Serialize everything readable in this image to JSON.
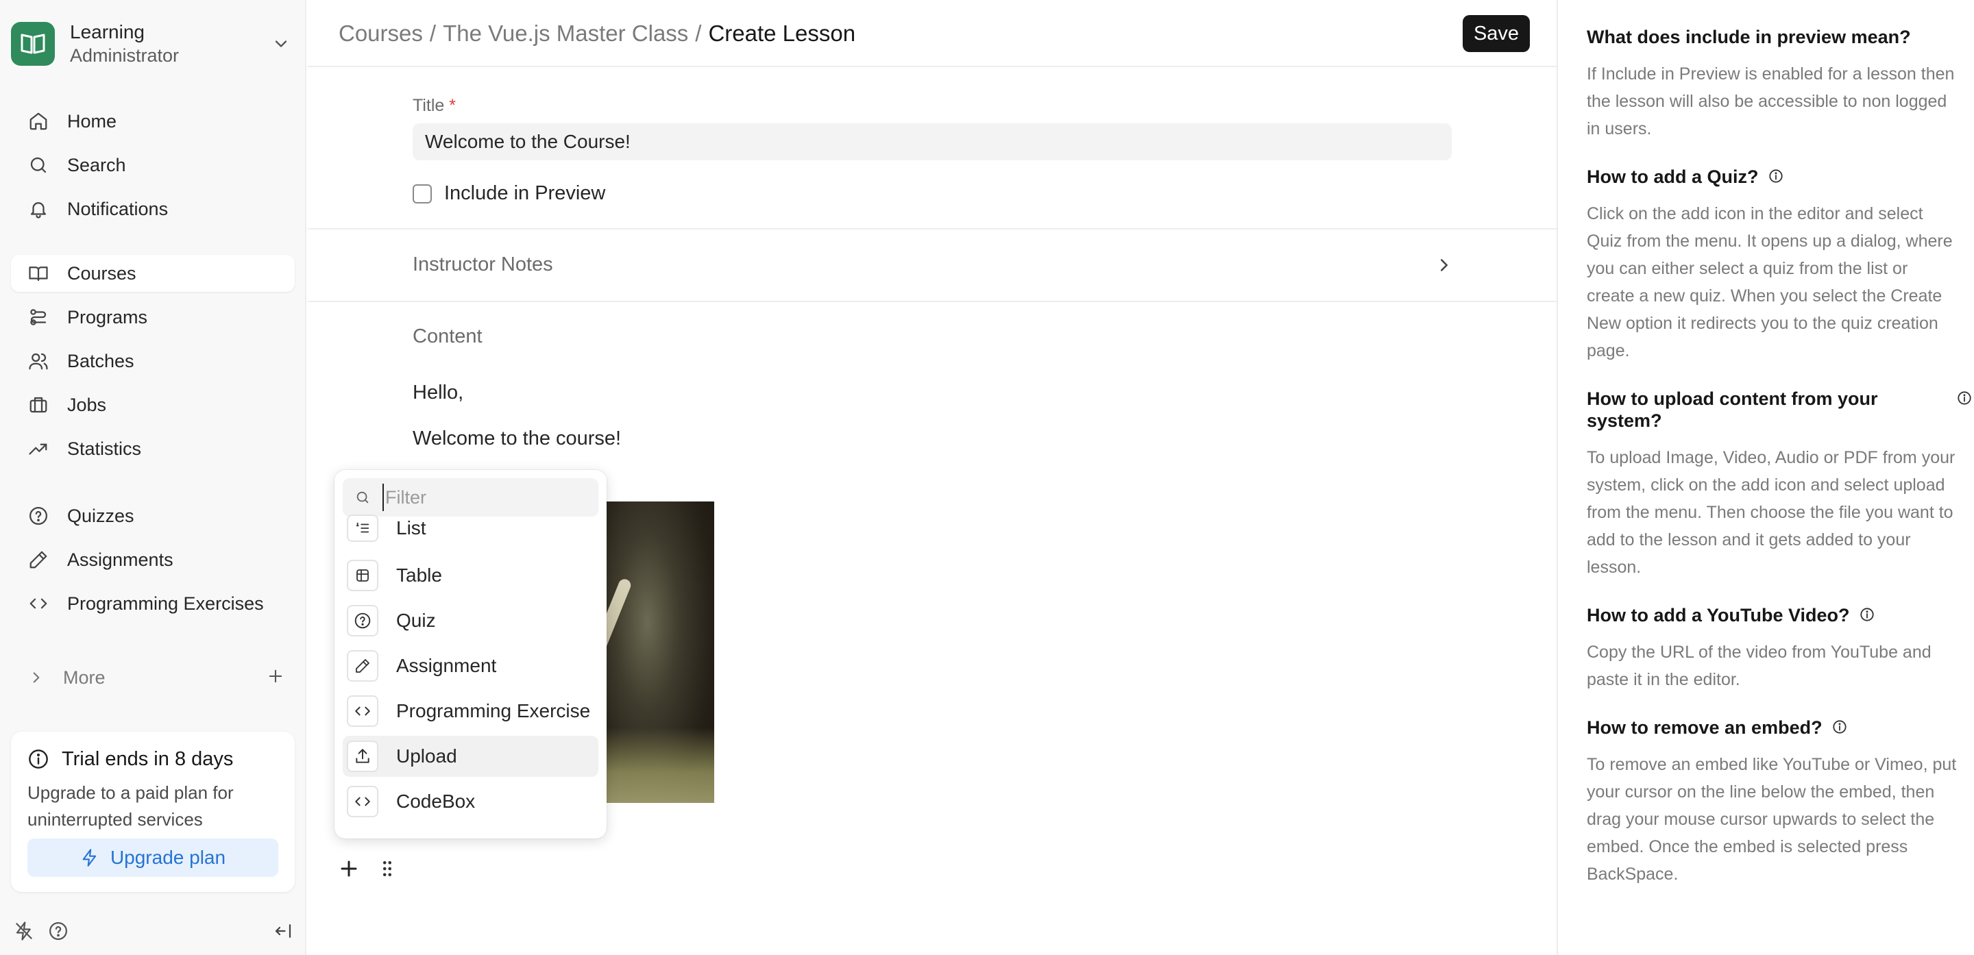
{
  "brand": {
    "title": "Learning",
    "subtitle": "Administrator",
    "color": "#2f8a5c"
  },
  "sidebar": {
    "nav_primary": [
      {
        "label": "Home",
        "icon": "home-icon"
      },
      {
        "label": "Search",
        "icon": "search-icon"
      },
      {
        "label": "Notifications",
        "icon": "bell-icon"
      }
    ],
    "nav_secondary": [
      {
        "label": "Courses",
        "icon": "book-icon",
        "active": true
      },
      {
        "label": "Programs",
        "icon": "route-icon"
      },
      {
        "label": "Batches",
        "icon": "users-icon"
      },
      {
        "label": "Jobs",
        "icon": "briefcase-icon"
      },
      {
        "label": "Statistics",
        "icon": "trending-up-icon"
      }
    ],
    "nav_tertiary": [
      {
        "label": "Quizzes",
        "icon": "help-circle-icon"
      },
      {
        "label": "Assignments",
        "icon": "pencil-icon"
      },
      {
        "label": "Programming Exercises",
        "icon": "code-icon"
      }
    ],
    "more_label": "More",
    "trial": {
      "title": "Trial ends in 8 days",
      "body": "Upgrade to a paid plan for uninterrupted services",
      "button": "Upgrade plan"
    }
  },
  "header": {
    "breadcrumb": [
      "Courses",
      "The Vue.js Master Class",
      "Create Lesson"
    ],
    "separator": "/",
    "save_label": "Save"
  },
  "form": {
    "title_label": "Title",
    "required_mark": "*",
    "title_value": "Welcome to the Course!",
    "include_preview_label": "Include in Preview",
    "include_preview_checked": false,
    "instructor_notes_label": "Instructor Notes",
    "content_label": "Content",
    "content_paragraphs": [
      "Hello,",
      "Welcome to the course!"
    ]
  },
  "insert_menu": {
    "filter_placeholder": "Filter",
    "items": [
      {
        "label": "List",
        "icon": "list-ordered-icon"
      },
      {
        "label": "Table",
        "icon": "table-icon"
      },
      {
        "label": "Quiz",
        "icon": "help-circle-icon"
      },
      {
        "label": "Assignment",
        "icon": "pencil-icon"
      },
      {
        "label": "Programming Exercise",
        "icon": "code-icon"
      },
      {
        "label": "Upload",
        "icon": "upload-icon",
        "highlighted": true
      },
      {
        "label": "CodeBox",
        "icon": "code-icon"
      }
    ]
  },
  "help": [
    {
      "question": "What does include in preview mean?",
      "answer": "If Include in Preview is enabled for a lesson then the lesson will also be accessible to non logged in users."
    },
    {
      "question": "How to add a Quiz?",
      "answer": "Click on the add icon in the editor and select Quiz from the menu. It opens up a dialog, where you can either select a quiz from the list or create a new quiz. When you select the Create New option it redirects you to the quiz creation page."
    },
    {
      "question": "How to upload content from your system?",
      "answer": "To upload Image, Video, Audio or PDF from your system, click on the add icon and select upload from the menu. Then choose the file you want to add to the lesson and it gets added to your lesson."
    },
    {
      "question": "How to add a YouTube Video?",
      "answer": "Copy the URL of the video from YouTube and paste it in the editor."
    },
    {
      "question": "How to remove an embed?",
      "answer": "To remove an embed like YouTube or Vimeo, put your cursor on the line below the embed, then drag your mouse cursor upwards to select the embed. Once the embed is selected press BackSpace."
    }
  ]
}
